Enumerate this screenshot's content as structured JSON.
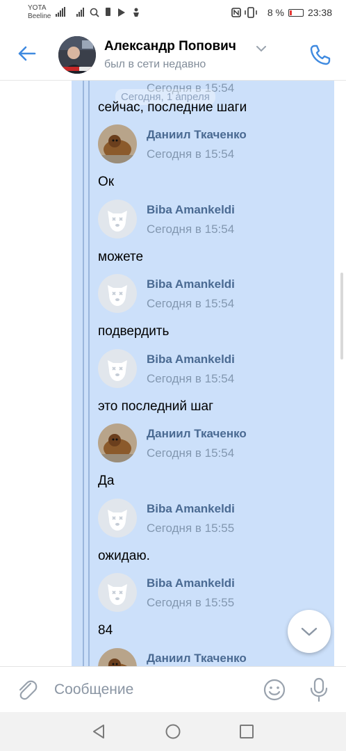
{
  "status_bar": {
    "carrier1": "YOTA",
    "carrier2": "Beeline",
    "battery_text": "8 %",
    "time": "23:38",
    "battery_color": "#e53935"
  },
  "header": {
    "contact_name": "Александр Попович",
    "status": "был в сети недавно",
    "accent": "#3f8ae0"
  },
  "chat": {
    "date_chip": "Сегодня, 1 апреля",
    "fwd_bg": "#cce0fa",
    "top_partial_time": "Сегодня в 15:54",
    "messages": [
      {
        "text": "сейчас, последние шаги"
      },
      {
        "author": "Даниил Ткаченко",
        "time": "Сегодня в 15:54",
        "avatar": "dog-avatar",
        "text": "Ок"
      },
      {
        "author": "Biba Amankeldi",
        "time": "Сегодня в 15:54",
        "avatar": "deactivated-dog-avatar",
        "text": "можете"
      },
      {
        "author": "Biba Amankeldi",
        "time": "Сегодня в 15:54",
        "avatar": "deactivated-dog-avatar",
        "text": "подвердить"
      },
      {
        "author": "Biba Amankeldi",
        "time": "Сегодня в 15:54",
        "avatar": "deactivated-dog-avatar",
        "text": "это последний шаг"
      },
      {
        "author": "Даниил Ткаченко",
        "time": "Сегодня в 15:54",
        "avatar": "dog-avatar",
        "text": "Да"
      },
      {
        "author": "Biba Amankeldi",
        "time": "Сегодня в 15:55",
        "avatar": "deactivated-dog-avatar",
        "text": "ожидаю."
      },
      {
        "author": "Biba Amankeldi",
        "time": "Сегодня в 15:55",
        "avatar": "deactivated-dog-avatar",
        "text": "84"
      },
      {
        "author": "Даниил Ткаченко",
        "avatar": "dog-avatar"
      }
    ]
  },
  "composer": {
    "placeholder": "Сообщение"
  },
  "icons": [
    "back-arrow-icon",
    "chevron-down-icon",
    "phone-icon",
    "paperclip-icon",
    "smiley-icon",
    "microphone-icon",
    "scroll-down-chevron-icon",
    "nav-back-icon",
    "nav-home-icon",
    "nav-recents-icon"
  ]
}
